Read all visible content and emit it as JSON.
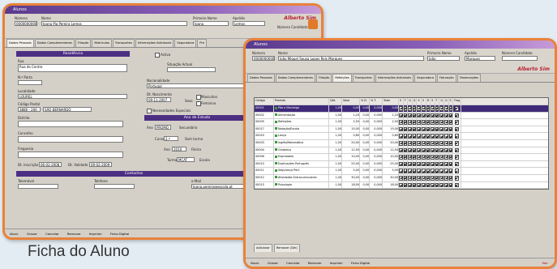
{
  "window_title": "Alunos",
  "brand": "Alberto Sim",
  "caption": "Ficha do Aluno",
  "w1": {
    "header": {
      "numero_label": "Número",
      "numero_value": "00000000000",
      "nome_label": "Nome",
      "nome_value": "Joana Pia Pereira Lemos",
      "primeiro_label": "Primeiro Nome",
      "primeiro_value": "Joana",
      "apelido_label": "Apelido",
      "apelido_value": "Lemos",
      "numero_cand_label": "Número Candidato"
    },
    "tabs": [
      "Dados Pessoais",
      "Dados Complementares",
      "Filiação",
      "Matrículas",
      "Transportes",
      "Informações Adicionais",
      "Seguradora",
      "Pre"
    ],
    "section_residencia": "Residência",
    "rua_label": "Rua",
    "rua_value": "Rua do Centro",
    "n_porta_label": "N.º Porta",
    "localidade_label": "Localidade",
    "localidade_value": "LOUREL",
    "codigo_postal_label": "Código Postal",
    "codigo_postal_value": "3880 - 200",
    "codigo_postal_local": "SÃO BERNARDO",
    "distrito_label": "Distrito",
    "concelho_label": "Concelho",
    "freguesia_label": "Freguesia",
    "ativo_label": "Activo",
    "situacao_label": "Situação Actual",
    "nacionalidade_label": "Nacionalidade",
    "nacionalidade_value": "Portugal",
    "dt_nascimento_label": "Dt. Nascimento",
    "dt_nascimento_value": "09-11-2007",
    "sexo_label": "Sexo",
    "sexo_m": "Masculino",
    "sexo_f": "Feminino",
    "encarregado_label": "Necessidades Especiais",
    "section_ano": "Ano de Estudo",
    "ano_label": "Ano",
    "ano_value": "PROMO",
    "secundario_label": "Secundário",
    "curso_label": "Curso",
    "curso_value": "2.º",
    "sem_turma_label": "Sem turma",
    "ano2_label": "Ano",
    "ano2_value": "2010",
    "fiteira_label": "Fileira",
    "turma_label": "Turma",
    "turma_value": "MCAT",
    "escola_label": "Escola",
    "inscricao_label": "Dt. Inscrição",
    "inscricao_value": "06-02-2008",
    "validade_label": "Dt. Validade",
    "validade_value": "09-02-2009",
    "section_contactos": "Contactos",
    "telemovel_label": "Telemóvel",
    "telefone_label": "Telefone",
    "email_label": "e-Mail",
    "email_value": "Joana.pereira@escola.pt",
    "bottom": [
      "Atual.",
      "Gravar",
      "Cancelar",
      "Remover",
      "Imprimir",
      "Ficha Digital"
    ]
  },
  "w2": {
    "header": {
      "numero_label": "Número",
      "numero_value": "0000000000",
      "nome_label": "Nome",
      "nome_value": "João Miguel Sousa Lopes Reis Marques",
      "primeiro_label": "Primeiro Nome",
      "primeiro_value": "João",
      "apelido_label": "Apelido",
      "apelido_value": "Marques",
      "numero_cand_label": "Número Candidato"
    },
    "tabs": [
      "Dados Pessoais",
      "Dados Complementares",
      "Filiação",
      "Refeições",
      "Transportes",
      "Informações Adicionais",
      "Seguradora",
      "Faturação",
      "Observações"
    ],
    "active_tab": 3,
    "grid_headers": [
      "Código",
      "Produto",
      "Qtd.",
      "Valor",
      "% D.",
      "% T.",
      "Total",
      "S",
      "T",
      "Q",
      "Q",
      "S",
      "S",
      "D",
      "S",
      "T",
      "Q",
      "Q",
      "S",
      "Flag"
    ],
    "rows": [
      {
        "codigo": "00001",
        "produto": "Pão e Manteiga",
        "qtd": "1,00",
        "valor": "0,45",
        "d": "0,00",
        "t": "0,000",
        "total": "0,45"
      },
      {
        "codigo": "00002",
        "produto": "Alimentação",
        "qtd": "1,00",
        "valor": "1,20",
        "d": "0,00",
        "t": "0,000",
        "total": "1,20"
      },
      {
        "codigo": "00005",
        "produto": "Refeições",
        "qtd": "1,00",
        "valor": "2,50",
        "d": "0,00",
        "t": "0,000",
        "total": "2,50"
      },
      {
        "codigo": "00017",
        "produto": "Natação/Escola",
        "qtd": "1,00",
        "valor": "15,00",
        "d": "0,00",
        "t": "0,000",
        "total": "15,00"
      },
      {
        "codigo": "00020",
        "produto": "Lanço",
        "qtd": "1,00",
        "valor": "0,80",
        "d": "0,00",
        "t": "0,000",
        "total": "0,80"
      },
      {
        "codigo": "00003",
        "produto": "Inglês/Matemática",
        "qtd": "1,00",
        "valor": "20,00",
        "d": "0,00",
        "t": "0,000",
        "total": "20,00"
      },
      {
        "codigo": "00004",
        "produto": "Ginástica",
        "qtd": "1,00",
        "valor": "12,50",
        "d": "0,00",
        "t": "0,000",
        "total": "12,50"
      },
      {
        "codigo": "00006",
        "produto": "Expressões",
        "qtd": "1,00",
        "valor": "10,00",
        "d": "0,00",
        "t": "0,000",
        "total": "10,00"
      },
      {
        "codigo": "00010",
        "produto": "Explicações Português",
        "qtd": "1,00",
        "valor": "25,00",
        "d": "0,00",
        "t": "0,000",
        "total": "25,00"
      },
      {
        "codigo": "00011",
        "produto": "Segurança Port.",
        "qtd": "1,00",
        "valor": "5,00",
        "d": "0,00",
        "t": "0,000",
        "total": "5,00"
      },
      {
        "codigo": "00012",
        "produto": "Atividades Extracurriculares",
        "qtd": "1,00",
        "valor": "30,00",
        "d": "0,00",
        "t": "0,000",
        "total": "30,00"
      },
      {
        "codigo": "00015",
        "produto": "Psicologia",
        "qtd": "1,00",
        "valor": "18,00",
        "d": "0,00",
        "t": "0,000",
        "total": "18,00"
      }
    ],
    "subtabs": [
      "Adicionar",
      "Remover (Del)"
    ],
    "bottom": [
      "Atual.",
      "Gravar",
      "Cancelar",
      "Remover",
      "Imprimir",
      "Ficha Digital"
    ],
    "exit_label": "Sair"
  }
}
